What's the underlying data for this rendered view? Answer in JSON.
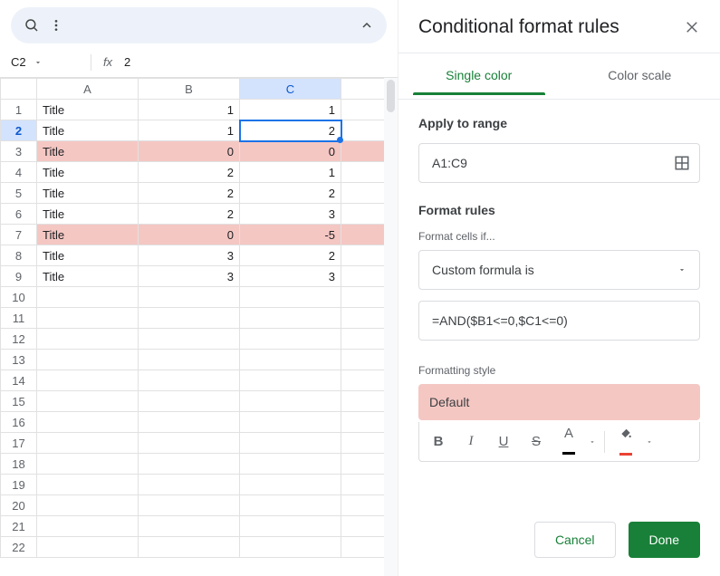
{
  "namebox": {
    "cell": "C2",
    "fx": "fx",
    "value": "2"
  },
  "columns": [
    "A",
    "B",
    "C"
  ],
  "active_col_index": 2,
  "active_row": 2,
  "row_count": 22,
  "rows": [
    {
      "A": "Title",
      "B": "1",
      "C": "1",
      "hl": false
    },
    {
      "A": "Title",
      "B": "1",
      "C": "2",
      "hl": false
    },
    {
      "A": "Title",
      "B": "0",
      "C": "0",
      "hl": true
    },
    {
      "A": "Title",
      "B": "2",
      "C": "1",
      "hl": false
    },
    {
      "A": "Title",
      "B": "2",
      "C": "2",
      "hl": false
    },
    {
      "A": "Title",
      "B": "2",
      "C": "3",
      "hl": false
    },
    {
      "A": "Title",
      "B": "0",
      "C": "-5",
      "hl": true
    },
    {
      "A": "Title",
      "B": "3",
      "C": "2",
      "hl": false
    },
    {
      "A": "Title",
      "B": "3",
      "C": "3",
      "hl": false
    }
  ],
  "panel": {
    "title": "Conditional format rules",
    "tabs": {
      "single": "Single color",
      "scale": "Color scale"
    },
    "apply_label": "Apply to range",
    "range_value": "A1:C9",
    "rules_label": "Format rules",
    "cells_if_label": "Format cells if...",
    "condition": "Custom formula is",
    "formula": "=AND($B1<=0,$C1<=0)",
    "style_label": "Formatting style",
    "preview_text": "Default",
    "cancel": "Cancel",
    "done": "Done",
    "fmt_B": "B",
    "fmt_I": "I",
    "fmt_U": "U",
    "fmt_S": "S",
    "fmt_A": "A"
  }
}
